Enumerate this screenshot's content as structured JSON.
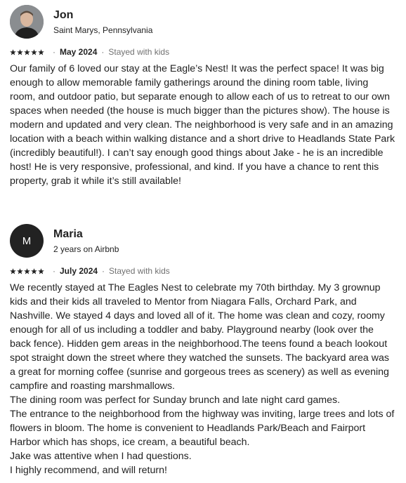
{
  "reviews": [
    {
      "name": "Jon",
      "subtitle": "Saint Marys, Pennsylvania",
      "rating": 5,
      "date": "May 2024",
      "stay": "Stayed with kids",
      "text": "Our family of 6 loved our stay at the Eagle’s Nest!  It was the perfect space!  It was big enough to allow memorable family gatherings around the dining room table, living room, and outdoor patio, but separate enough to allow each of us to retreat to our own spaces when needed (the house is much bigger than the pictures show).  The house is modern and updated and very clean.  The neighborhood is very safe and in an amazing location with a beach within walking distance and a short drive to Headlands State Park (incredibly beautiful!). I can’t say enough good things about Jake - he is an incredible host!  He is very responsive, professional, and kind.  If you have a chance to rent this property, grab it while it’s still available!"
    },
    {
      "name": "Maria",
      "initial": "M",
      "subtitle": "2 years on Airbnb",
      "rating": 5,
      "date": "July 2024",
      "stay": "Stayed with kids",
      "text": "We recently stayed at The Eagles Nest to celebrate my 70th birthday. My 3 grownup kids and their kids all traveled to Mentor from Niagara Falls, Orchard Park, and Nashville. We stayed 4 days and loved all of it. The home was clean and cozy, roomy enough for all of us including a toddler and baby. Playground nearby (look over the back fence). Hidden gem areas in the neighborhood.The teens found a beach lookout spot straight down the street where they watched the sunsets. The backyard area was a great for morning coffee (sunrise and gorgeous trees as scenery) as well as evening campfire and roasting marshmallows.\nThe dining room was perfect for Sunday brunch and late night card games.\nThe entrance to the neighborhood from the highway was inviting, large trees and lots of flowers in bloom. The home is convenient to Headlands Park/Beach and Fairport Harbor which has shops, ice cream, a beautiful beach.\nJake was attentive when I had questions.\nI highly recommend, and will return!"
    }
  ]
}
